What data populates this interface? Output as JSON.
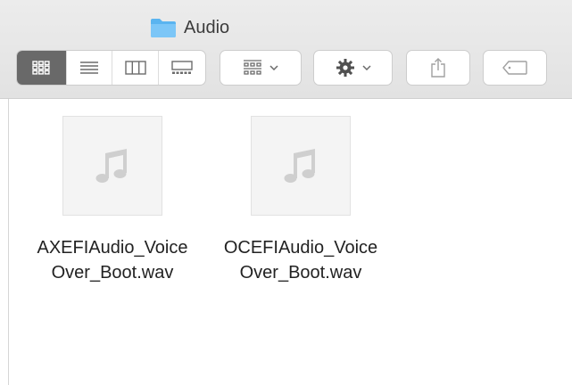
{
  "window": {
    "title": "Audio",
    "title_icon": "folder-icon"
  },
  "toolbar": {
    "view_modes": [
      {
        "name": "icon-view",
        "icon": "grid-icon",
        "active": true
      },
      {
        "name": "list-view",
        "icon": "list-icon",
        "active": false
      },
      {
        "name": "column-view",
        "icon": "columns-icon",
        "active": false
      },
      {
        "name": "gallery-view",
        "icon": "gallery-icon",
        "active": false
      }
    ],
    "group_by_icon": "group-by-icon",
    "action_icon": "gear-icon",
    "share_icon": "share-icon",
    "tags_icon": "tag-icon"
  },
  "files": [
    {
      "name_line1": "AXEFIAudio_Voice",
      "name_line2": "Over_Boot.wav",
      "icon": "music-note-icon"
    },
    {
      "name_line1": "OCEFIAudio_Voice",
      "name_line2": "Over_Boot.wav",
      "icon": "music-note-icon"
    }
  ],
  "colors": {
    "folder": "#5ab4f0",
    "active_segment": "#696969",
    "icon_gray": "#6b6b6b"
  }
}
